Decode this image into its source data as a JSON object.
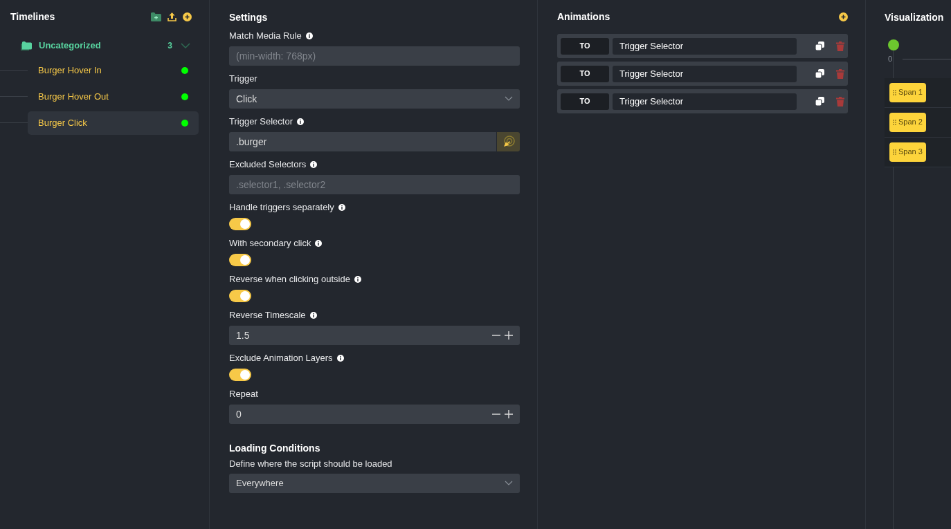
{
  "timelines": {
    "title": "Timelines",
    "category": {
      "name": "Uncategorized",
      "count": "3",
      "expanded": true
    },
    "items": [
      {
        "name": "Burger Hover In",
        "selected": false,
        "color": "#00ff00"
      },
      {
        "name": "Burger Hover Out",
        "selected": false,
        "color": "#00ff00"
      },
      {
        "name": "Burger Click",
        "selected": true,
        "color": "#00ff00"
      }
    ]
  },
  "settings": {
    "title": "Settings",
    "fields": [
      {
        "kind": "text",
        "label": "Match Media Rule",
        "info": true,
        "placeholder": "(min-width: 768px)"
      },
      {
        "kind": "select",
        "label": "Trigger",
        "info": false,
        "value": "Click"
      },
      {
        "kind": "selector",
        "label": "Trigger Selector",
        "info": true,
        "value": ".burger"
      },
      {
        "kind": "text",
        "label": "Excluded Selectors",
        "info": true,
        "placeholder": ".selector1, .selector2"
      },
      {
        "kind": "toggle",
        "label": "Handle triggers separately",
        "info": true,
        "on": true
      },
      {
        "kind": "toggle",
        "label": "With secondary click",
        "info": true,
        "on": true
      },
      {
        "kind": "toggle",
        "label": "Reverse when clicking outside",
        "info": true,
        "on": true
      },
      {
        "kind": "number",
        "label": "Reverse Timescale",
        "info": true,
        "value": "1.5"
      },
      {
        "kind": "toggle",
        "label": "Exclude Animation Layers",
        "info": true,
        "on": true
      },
      {
        "kind": "number",
        "label": "Repeat",
        "info": false,
        "value": "0"
      }
    ],
    "loading": {
      "title": "Loading Conditions",
      "label": "Define where the script should be loaded",
      "value": "Everywhere"
    }
  },
  "animations": {
    "title": "Animations",
    "rows": [
      {
        "type": "TO",
        "selector": "Trigger Selector"
      },
      {
        "type": "TO",
        "selector": "Trigger Selector"
      },
      {
        "type": "TO",
        "selector": "Trigger Selector"
      }
    ]
  },
  "visualization": {
    "title": "Visualization",
    "tick": "0",
    "spans": [
      "Span 1",
      "Span 2",
      "Span 3"
    ]
  }
}
